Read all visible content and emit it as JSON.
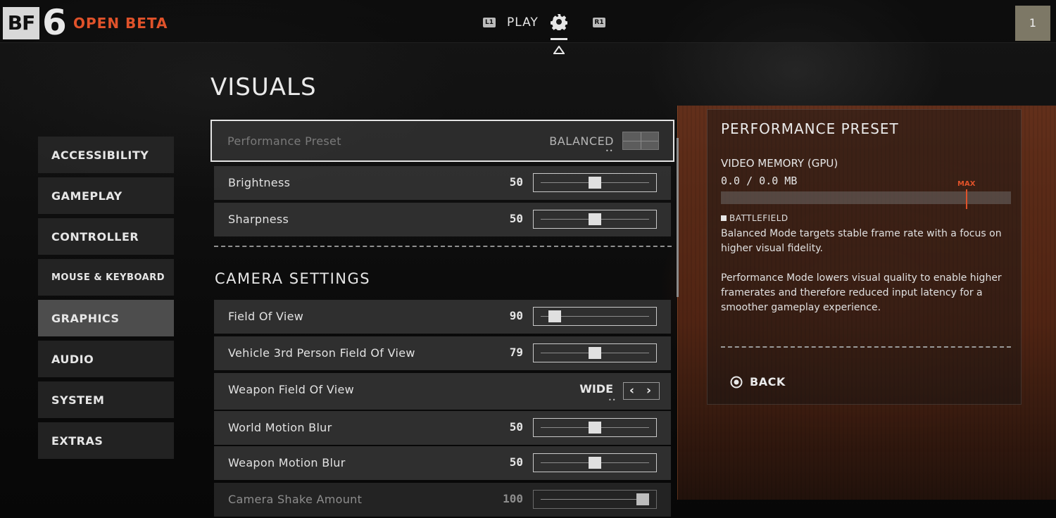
{
  "header": {
    "logo_text": "BF",
    "logo_number": "6",
    "beta_label": "OPEN BETA",
    "tab_left_hint": "L1",
    "tab_play": "PLAY",
    "tab_right_hint": "R1",
    "profile_level": "1"
  },
  "page_title": "VISUALS",
  "sidebar": {
    "items": [
      {
        "label": "ACCESSIBILITY"
      },
      {
        "label": "GAMEPLAY"
      },
      {
        "label": "CONTROLLER"
      },
      {
        "label": "MOUSE & KEYBOARD"
      },
      {
        "label": "GRAPHICS",
        "active": true
      },
      {
        "label": "AUDIO"
      },
      {
        "label": "SYSTEM"
      },
      {
        "label": "EXTRAS"
      }
    ]
  },
  "settings": {
    "performance_preset": {
      "label": "Performance Preset",
      "value": "BALANCED"
    },
    "brightness": {
      "label": "Brightness",
      "value": "50",
      "level": 0.5
    },
    "sharpness": {
      "label": "Sharpness",
      "value": "50",
      "level": 0.5
    },
    "camera_section_title": "CAMERA SETTINGS",
    "fov": {
      "label": "Field Of View",
      "value": "90",
      "level": 0.08
    },
    "vehicle_fov": {
      "label": "Vehicle 3rd Person Field Of View",
      "value": "79",
      "level": 0.5
    },
    "weapon_fov": {
      "label": "Weapon Field Of View",
      "value": "WIDE"
    },
    "world_motion_blur": {
      "label": "World Motion Blur",
      "value": "50",
      "level": 0.5
    },
    "weapon_motion_blur": {
      "label": "Weapon Motion Blur",
      "value": "50",
      "level": 0.5
    },
    "camera_shake": {
      "label": "Camera Shake Amount",
      "value": "100",
      "level": 1.0
    }
  },
  "info_panel": {
    "title": "PERFORMANCE PRESET",
    "memory_label": "VIDEO MEMORY (GPU)",
    "memory_value": "0.0 / 0.0 MB",
    "max_label": "MAX",
    "tag": "BATTLEFIELD",
    "description_1": "Balanced Mode targets stable frame rate with a focus on higher visual fidelity.",
    "description_2": "Performance Mode lowers visual quality to enable higher framerates and therefore reduced input latency for a smoother gameplay experience.",
    "back_label": "BACK"
  },
  "colors": {
    "accent": "#e0522a",
    "row_bg": "#343434",
    "active_tab_bg": "#4d4d4d"
  }
}
